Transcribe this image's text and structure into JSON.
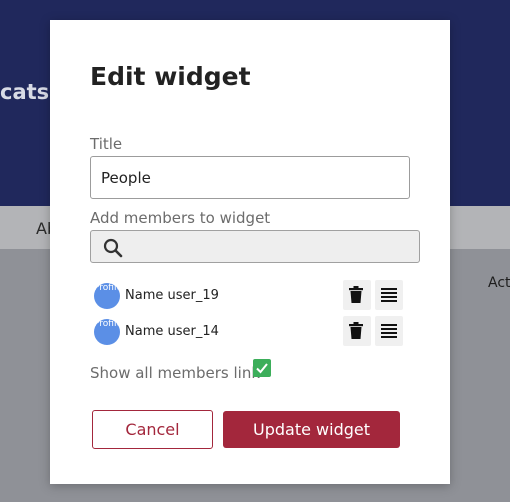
{
  "background": {
    "header_title": "cats",
    "tab_label": "Ab",
    "right_label": "Act"
  },
  "dialog": {
    "title": "Edit widget",
    "title_field": {
      "label": "Title",
      "value": "People"
    },
    "add_members": {
      "label": "Add members to widget",
      "placeholder": ""
    },
    "members": [
      {
        "avatar_alt": "Profile",
        "name": "Name user_19"
      },
      {
        "avatar_alt": "Profile",
        "name": "Name user_14"
      }
    ],
    "show_all_members": {
      "label": "Show all members link",
      "checked": true
    },
    "cancel_label": "Cancel",
    "update_label": "Update widget"
  },
  "colors": {
    "accent": "#a3273c",
    "checkbox": "#3cae5a",
    "avatar": "#5b8fe6",
    "header_bg": "#20285c"
  }
}
